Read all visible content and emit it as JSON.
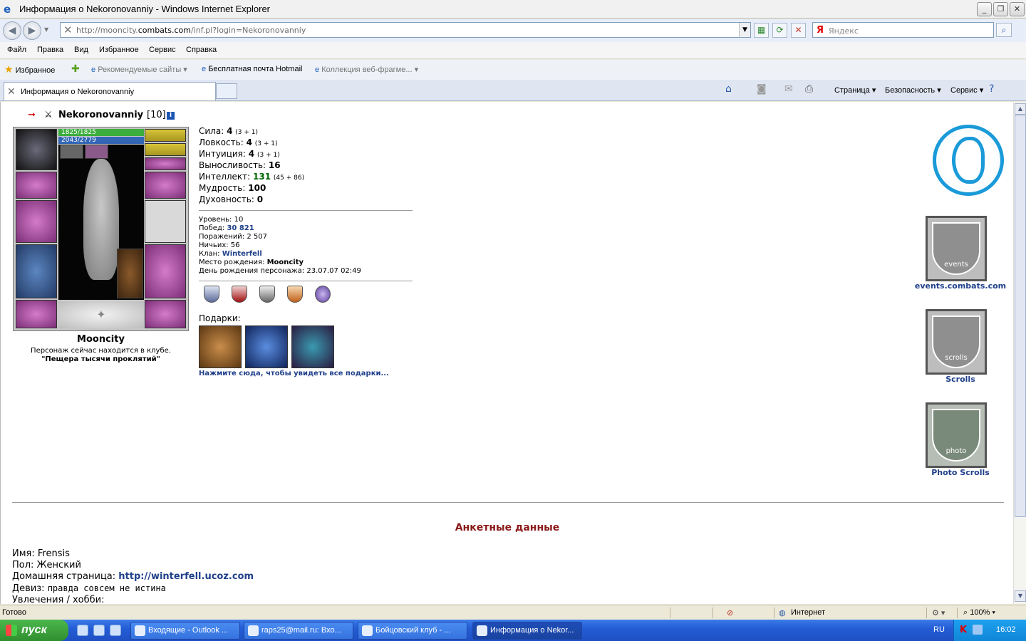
{
  "window": {
    "title": "Информация о Nekoronovanniy - Windows Internet Explorer"
  },
  "address": {
    "url_prefix": "http://mooncity.",
    "url_domain": "combats.com",
    "url_suffix": "/inf.pl?login=Nekoronovanniy",
    "search_placeholder": "Яндекс"
  },
  "menu": [
    "Файл",
    "Правка",
    "Вид",
    "Избранное",
    "Сервис",
    "Справка"
  ],
  "favorites": {
    "label": "Избранное",
    "items": [
      "Рекомендуемые сайты ▾",
      "Бесплатная почта Hotmail",
      "Коллекция веб-фрагме...  ▾"
    ]
  },
  "tab": {
    "label": "Информация о Nekoronovanniy"
  },
  "commandbar": [
    "Страница ▾",
    "Безопасность ▾",
    "Сервис ▾"
  ],
  "character": {
    "name": "Nekoronovanniy",
    "level_tag": "[10]",
    "hp": "1825/1825",
    "mp": "2043/2779",
    "city": "Mooncity",
    "club_line1": "Персонаж сейчас находится в клубе.",
    "club_line2": "\"Пещера тысячи проклятий\""
  },
  "stats": [
    {
      "label": "Сила:",
      "value": "4",
      "bonus": "(3 + 1)"
    },
    {
      "label": "Ловкость:",
      "value": "4",
      "bonus": "(3 + 1)"
    },
    {
      "label": "Интуиция:",
      "value": "4",
      "bonus": "(3 + 1)"
    },
    {
      "label": "Выносливость:",
      "value": "16",
      "bonus": ""
    },
    {
      "label": "Интеллект:",
      "value": "131",
      "bonus": "(45 + 86)"
    },
    {
      "label": "Мудрость:",
      "value": "100",
      "bonus": ""
    },
    {
      "label": "Духовность:",
      "value": "0",
      "bonus": ""
    }
  ],
  "info": {
    "level": "Уровень: 10",
    "wins_label": "Побед:",
    "wins_value": "30 821",
    "losses": "Поражений: 2 507",
    "draws": "Ничьих: 56",
    "clan_label": "Клан:",
    "clan_value": "Winterfell",
    "birthplace_label": "Место рождения:",
    "birthplace_value": "Mooncity",
    "birthday": "День рождения персонажа: 23.07.07 02:49"
  },
  "gifts": {
    "label": "Подарки:",
    "link": "Нажмите сюда, чтобы увидеть все подарки..."
  },
  "sidebar": {
    "events_label": "events.combats.com",
    "events_icon_text": "events",
    "scrolls_label": "Scrolls",
    "scrolls_icon_text": "scrolls",
    "photo_label": "Photo Scrolls",
    "photo_icon_text": "photo"
  },
  "profile": {
    "heading": "Анкетные данные",
    "name": "Имя: Frensis",
    "gender": "Пол: Женский",
    "homepage_label": "Домашняя страница:",
    "homepage_url": "http://winterfell.ucoz.com",
    "motto_label": "Девиз:",
    "motto_value": "правда совсем не истина",
    "hobby_label": "Увлечения / хобби:"
  },
  "status": {
    "text": "Готово",
    "zone": "Интернет",
    "zoom": "100%"
  },
  "taskbar": {
    "start": "пуск",
    "buttons": [
      "Входящие - Outlook ...",
      "raps25@mail.ru: Вхо...",
      "Бойцовский клуб - ...",
      "Информация о Nekor..."
    ],
    "lang": "RU",
    "time": "16:02"
  },
  "colors": {
    "link": "#1f3f8a",
    "heading": "#8b1a1a",
    "hp": "#3dae3d",
    "mp": "#3366b6"
  }
}
